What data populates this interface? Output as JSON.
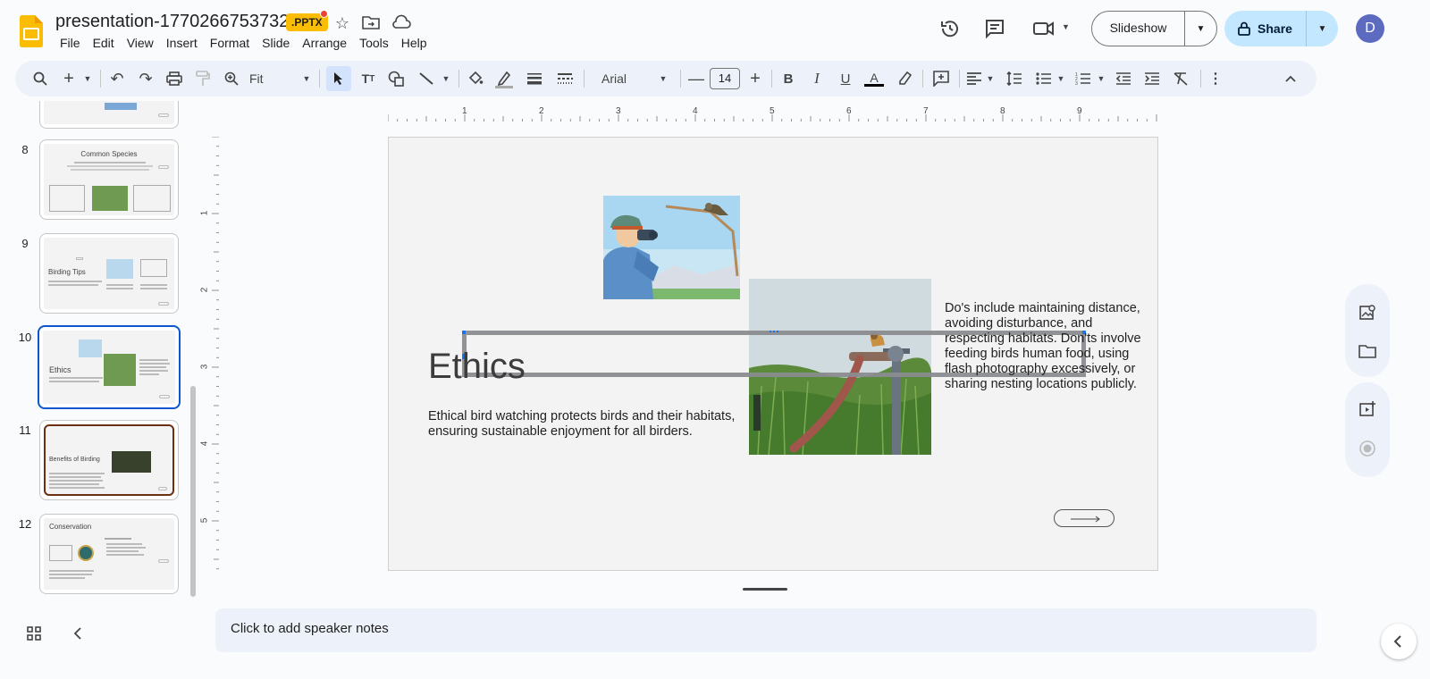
{
  "document": {
    "title": "presentation-1770266753732",
    "badge": ".PPTX"
  },
  "menu": [
    "File",
    "Edit",
    "View",
    "Insert",
    "Format",
    "Slide",
    "Arrange",
    "Tools",
    "Help"
  ],
  "header": {
    "slideshow_label": "Slideshow",
    "share_label": "Share",
    "avatar_letter": "D"
  },
  "toolbar": {
    "zoom_label": "Fit",
    "font_name": "Arial",
    "font_size": "14"
  },
  "ruler": {
    "h": [
      "1",
      "2",
      "3",
      "4",
      "5",
      "6",
      "7",
      "8",
      "9"
    ],
    "v": [
      "1",
      "2",
      "3",
      "4",
      "5"
    ]
  },
  "thumbnails": [
    {
      "num": "8",
      "title": "Common Species"
    },
    {
      "num": "9",
      "title": "Birding Tips"
    },
    {
      "num": "10",
      "title": "Ethics"
    },
    {
      "num": "11",
      "title": "Benefits of Birding"
    },
    {
      "num": "12",
      "title": "Conservation"
    }
  ],
  "slide": {
    "title": "Ethics",
    "body": "Ethical bird watching protects birds and their habitats, ensuring sustainable enjoyment for all birders.",
    "side_text": "Do's include maintaining distance, avoiding disturbance, and respecting habitats. Don'ts involve feeding birds human food, using flash photography excessively, or sharing nesting locations publicly."
  },
  "notes": {
    "placeholder": "Click to add speaker notes"
  },
  "colors": {
    "accent": "#0b57d0",
    "share_bg": "#c2e7ff",
    "toolbar_bg": "#edf2fa",
    "logo": "#fbbc04"
  }
}
